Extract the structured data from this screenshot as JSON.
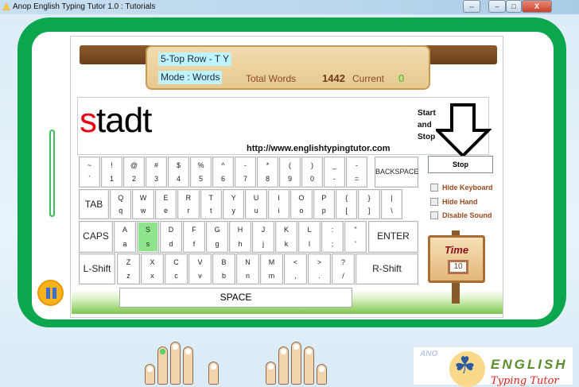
{
  "window": {
    "title": "Anop English Typing Tutor 1.0 : Tutorials",
    "buttons": [
      "⇔",
      "–",
      "□",
      "X"
    ]
  },
  "banner": {
    "lesson": "5-Top Row - T Y",
    "mode": "Mode : Words",
    "total_words_label": "Total Words",
    "total_words": "1442",
    "current_label": "Current",
    "current": "0"
  },
  "typing": {
    "word_typed": "s",
    "word_rest": "tadt",
    "url": "http://www.englishtypingtutor.com",
    "start_stop_hint": "Start\nand\nStop"
  },
  "keyboard": {
    "row1": [
      [
        "~",
        "`"
      ],
      [
        "!",
        "1"
      ],
      [
        "@",
        "2"
      ],
      [
        "#",
        "3"
      ],
      [
        "$",
        "4"
      ],
      [
        "%",
        "5"
      ],
      [
        "^",
        "6"
      ],
      [
        "-",
        "7"
      ],
      [
        "*",
        "8"
      ],
      [
        "(",
        "9"
      ],
      [
        ")",
        "0"
      ],
      [
        "_",
        "-"
      ],
      [
        "-",
        "="
      ]
    ],
    "backspace": "BACKSPACE",
    "tab": "TAB",
    "row2": [
      [
        "Q",
        "q"
      ],
      [
        "W",
        "w"
      ],
      [
        "E",
        "e"
      ],
      [
        "R",
        "r"
      ],
      [
        "T",
        "t"
      ],
      [
        "Y",
        "y"
      ],
      [
        "U",
        "u"
      ],
      [
        "I",
        "i"
      ],
      [
        "O",
        "o"
      ],
      [
        "P",
        "p"
      ],
      [
        "{",
        "["
      ],
      [
        "}",
        "]"
      ],
      [
        "|",
        "\\"
      ]
    ],
    "caps": "CAPS",
    "enter": "ENTER",
    "row3": [
      [
        "A",
        "a"
      ],
      [
        "S",
        "s"
      ],
      [
        "D",
        "d"
      ],
      [
        "F",
        "f"
      ],
      [
        "G",
        "g"
      ],
      [
        "H",
        "h"
      ],
      [
        "J",
        "j"
      ],
      [
        "K",
        "k"
      ],
      [
        "L",
        "l"
      ],
      [
        ":",
        ";"
      ],
      [
        "\"",
        "'"
      ]
    ],
    "lshift": "L-Shift",
    "rshift": "R-Shift",
    "row4": [
      [
        "Z",
        "z"
      ],
      [
        "X",
        "x"
      ],
      [
        "C",
        "c"
      ],
      [
        "V",
        "v"
      ],
      [
        "B",
        "b"
      ],
      [
        "N",
        "n"
      ],
      [
        "M",
        "m"
      ],
      [
        "<",
        ","
      ],
      [
        ">",
        "."
      ],
      [
        "?",
        "/"
      ]
    ],
    "space": "SPACE",
    "highlight_key": "S"
  },
  "controls": {
    "stop": "Stop",
    "hide_keyboard": "Hide Keyboard",
    "hide_hand": "Hide Hand",
    "disable_sound": "Disable Sound"
  },
  "timer": {
    "label": "Time",
    "value": "10"
  },
  "logo": {
    "side": "ANO",
    "title": "ENGLISH",
    "subtitle": "Typing Tutor"
  }
}
